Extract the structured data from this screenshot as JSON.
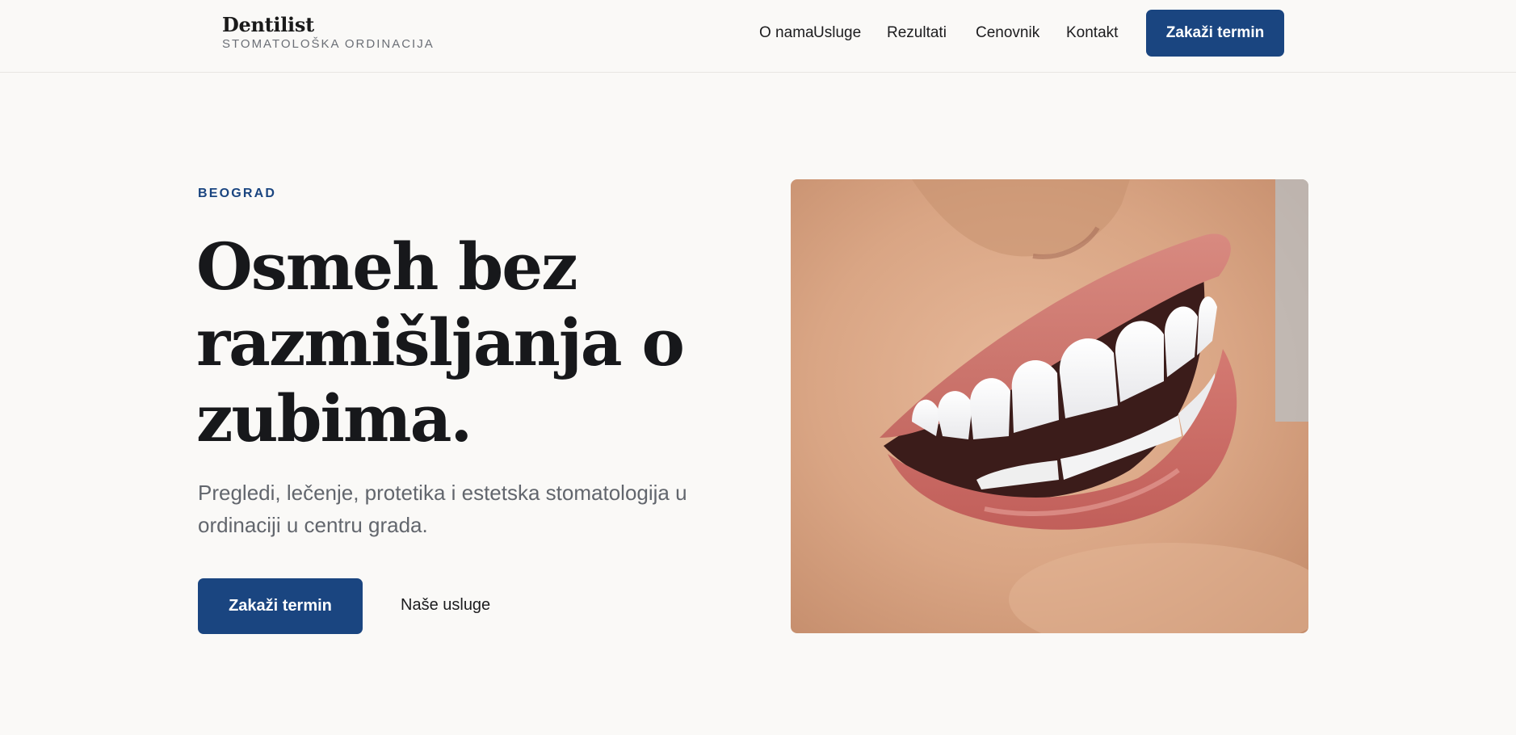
{
  "brand": {
    "name": "Dentilist",
    "subtitle": "STOMATOLOŠKA ORDINACIJA"
  },
  "nav": {
    "items": [
      {
        "label": "O nama"
      },
      {
        "label": "Usluge"
      },
      {
        "label": "Rezultati"
      },
      {
        "label": "Cenovnik"
      },
      {
        "label": "Kontakt"
      }
    ],
    "cta_label": "Zakaži termin"
  },
  "hero": {
    "eyebrow": "BEOGRAD",
    "headline": "Osmeh bez razmišljanja o zubima.",
    "lead": "Pregledi, lečenje, protetika i estetska stomatologija u ordinaciji u centru grada.",
    "primary_button": "Zakaži termin",
    "secondary_link": "Naše usluge",
    "image_subject": "smiling-mouth-photo"
  },
  "colors": {
    "accent": "#1a4580",
    "background": "#faf9f7",
    "text": "#17181b",
    "muted": "#62666d"
  }
}
